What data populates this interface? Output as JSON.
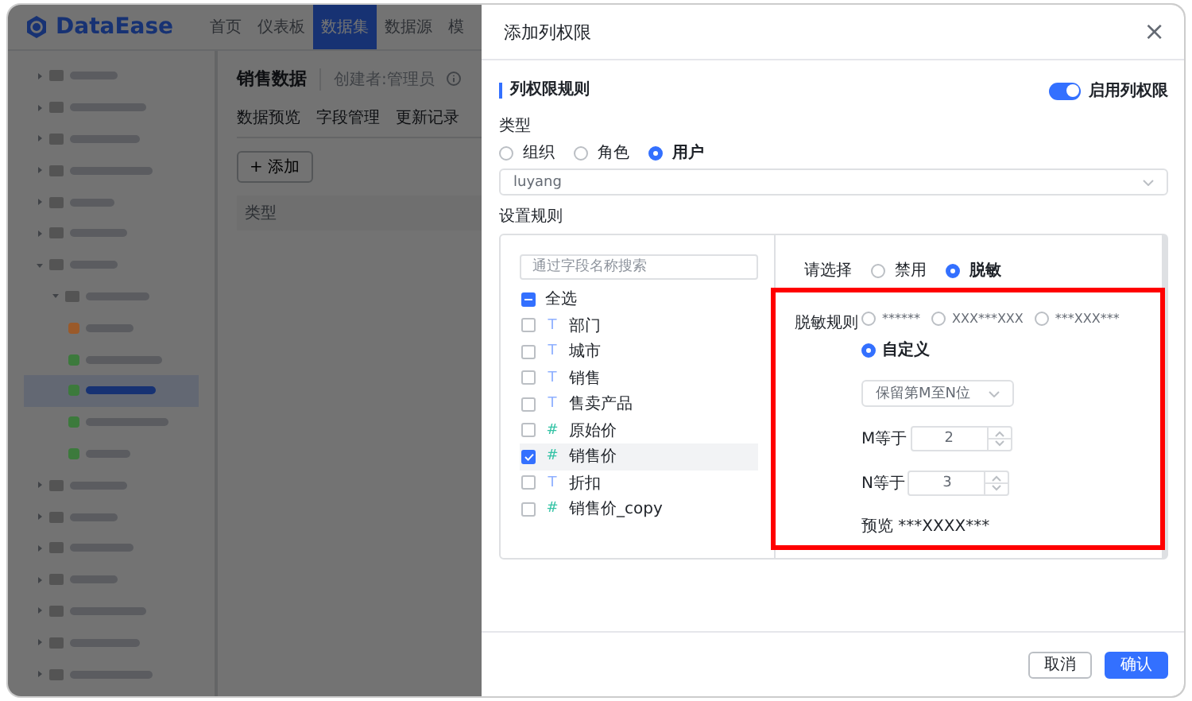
{
  "app": {
    "logo": "DataEase",
    "nav": [
      {
        "label": "首页",
        "selected": false
      },
      {
        "label": "仪表板",
        "selected": false
      },
      {
        "label": "数据集",
        "selected": true
      },
      {
        "label": "数据源",
        "selected": false
      },
      {
        "label": "模",
        "selected": false
      }
    ],
    "sidebar": {
      "items": [
        {
          "kind": "folder",
          "expanded": false
        },
        {
          "kind": "folder",
          "expanded": false
        },
        {
          "kind": "folder",
          "expanded": false
        },
        {
          "kind": "folder",
          "expanded": false
        },
        {
          "kind": "folder",
          "expanded": false
        },
        {
          "kind": "folder",
          "expanded": false
        },
        {
          "kind": "folder",
          "expanded": true,
          "children": [
            {
              "kind": "folder",
              "expanded": true,
              "children": [
                {
                  "kind": "dataset",
                  "color": "#9a5a2a",
                  "selected": false
                },
                {
                  "kind": "dataset",
                  "color": "#3c7a3c",
                  "selected": false
                },
                {
                  "kind": "dataset",
                  "color": "#3c7a3c",
                  "selected": true
                },
                {
                  "kind": "dataset",
                  "color": "#3c7a3c",
                  "selected": false
                },
                {
                  "kind": "dataset",
                  "color": "#3c7a3c",
                  "selected": false
                }
              ]
            }
          ]
        },
        {
          "kind": "folder",
          "expanded": false
        },
        {
          "kind": "folder",
          "expanded": false
        },
        {
          "kind": "folder",
          "expanded": false
        },
        {
          "kind": "folder",
          "expanded": false
        },
        {
          "kind": "folder",
          "expanded": false
        },
        {
          "kind": "folder",
          "expanded": false
        },
        {
          "kind": "folder",
          "expanded": false
        }
      ]
    },
    "dataset": {
      "title": "销售数据",
      "creator": "创建者:管理员",
      "tabs": [
        {
          "label": "数据预览",
          "selected": false
        },
        {
          "label": "字段管理",
          "selected": false
        },
        {
          "label": "更新记录",
          "selected": false
        }
      ],
      "add_button": "+ 添加",
      "table": {
        "columns": [
          "类型"
        ]
      }
    }
  },
  "drawer": {
    "title": "添加列权限",
    "close": "×",
    "section": "列权限规则",
    "enable": {
      "label": "启用列权限",
      "on": true
    },
    "type_label": "类型",
    "types": [
      {
        "label": "组织",
        "selected": false
      },
      {
        "label": "角色",
        "selected": false
      },
      {
        "label": "用户",
        "selected": true
      }
    ],
    "user_select": {
      "value": "luyang"
    },
    "rules_label": "设置规则",
    "field_search": {
      "placeholder": "通过字段名称搜索"
    },
    "select_all": {
      "label": "全选",
      "indeterminate": true
    },
    "fields": [
      {
        "name": "部门",
        "kind": "text",
        "type_icon": "T",
        "checked": false
      },
      {
        "name": "城市",
        "kind": "text",
        "type_icon": "T",
        "checked": false
      },
      {
        "name": "销售",
        "kind": "text",
        "type_icon": "T",
        "checked": false
      },
      {
        "name": "售卖产品",
        "kind": "text",
        "type_icon": "T",
        "checked": false
      },
      {
        "name": "原始价",
        "kind": "number",
        "type_icon": "#",
        "checked": false
      },
      {
        "name": "销售价",
        "kind": "number",
        "type_icon": "#",
        "checked": true
      },
      {
        "name": "折扣",
        "kind": "text",
        "type_icon": "T",
        "checked": false
      },
      {
        "name": "销售价_copy",
        "kind": "number",
        "type_icon": "#",
        "checked": false
      }
    ],
    "mode_label": "请选择",
    "modes": [
      {
        "label": "禁用",
        "selected": false
      },
      {
        "label": "脱敏",
        "selected": true
      }
    ],
    "mask_rule_label": "脱敏规则",
    "mask_rules": [
      {
        "label": "******",
        "selected": false
      },
      {
        "label": "XXX***XXX",
        "selected": false
      },
      {
        "label": "***XXX***",
        "selected": false
      },
      {
        "label": "自定义",
        "selected": true
      }
    ],
    "highlighted": true,
    "custom": {
      "select": {
        "value": "保留第M至N位"
      },
      "m": {
        "label": "M等于",
        "value": "2"
      },
      "n": {
        "label": "N等于",
        "value": "3"
      },
      "preview": "预览 ***XXXX***"
    },
    "buttons": [
      {
        "label": "取消",
        "kind": "secondary"
      },
      {
        "label": "确认",
        "kind": "primary"
      }
    ]
  }
}
